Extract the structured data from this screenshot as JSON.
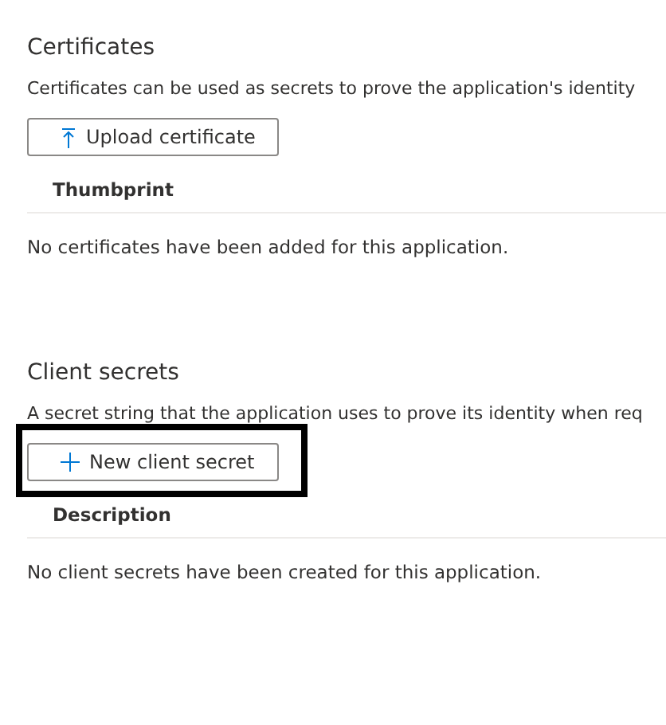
{
  "sections": [
    {
      "title": "Certificates",
      "description": "Certificates can be used as secrets to prove the application's identity",
      "button": {
        "label": "Upload certificate",
        "kind": "upload",
        "highlighted": false
      },
      "column": "Thumbprint",
      "empty_message": "No certificates have been added for this application."
    },
    {
      "title": "Client secrets",
      "description": "A secret string that the application uses to prove its identity when req",
      "button": {
        "label": "New client secret",
        "kind": "add",
        "highlighted": true
      },
      "column": "Description",
      "empty_message": "No client secrets have been created for this application."
    }
  ]
}
